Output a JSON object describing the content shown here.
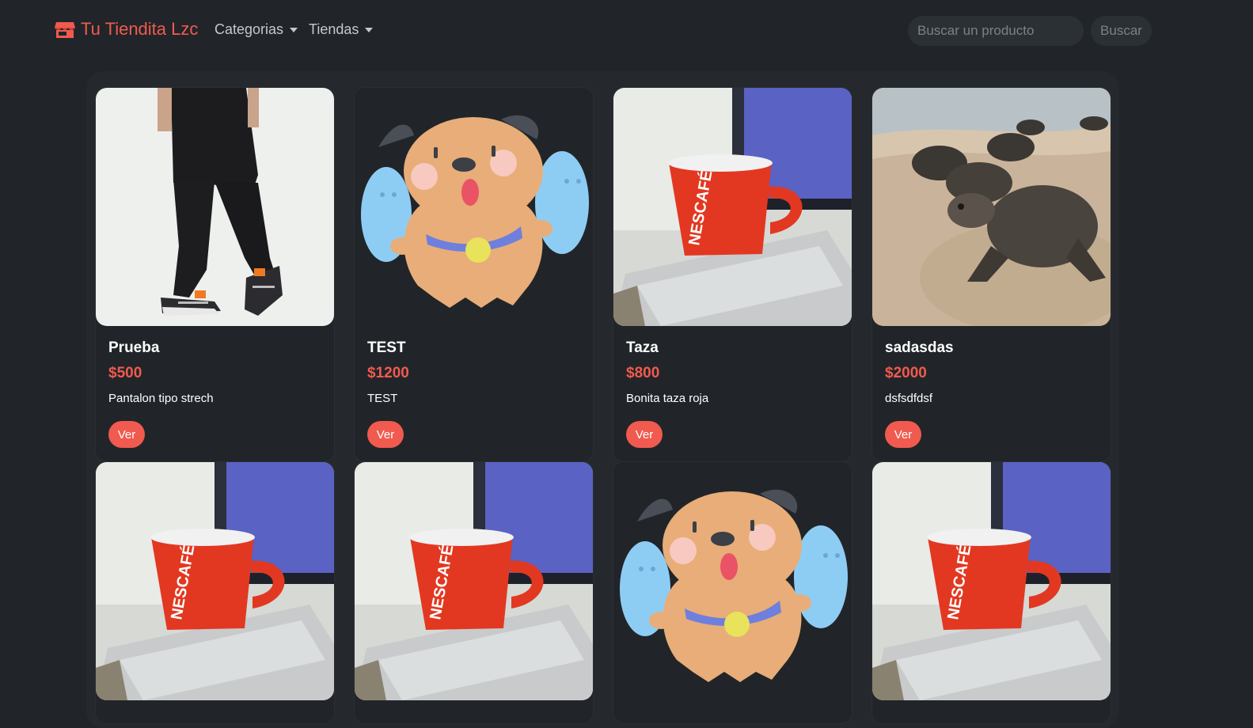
{
  "navbar": {
    "brand": "Tu Tiendita Lzc",
    "brand_icon": "store-icon",
    "menu": [
      {
        "label": "Categorias",
        "icon": "chevron-down-icon"
      },
      {
        "label": "Tiendas",
        "icon": "chevron-down-icon"
      }
    ],
    "search": {
      "value": "",
      "placeholder": "Buscar un producto",
      "button": "Buscar"
    }
  },
  "colors": {
    "background": "#212529",
    "accent": "#f15a4f",
    "card_bg": "#212529",
    "panel_bg": "#25292d"
  },
  "products": [
    {
      "name": "Prueba",
      "price": "$500",
      "description": "Pantalon tipo strech",
      "button": "Ver",
      "image": "pants-photo"
    },
    {
      "name": "TEST",
      "price": "$1200",
      "description": "TEST",
      "button": "Ver",
      "image": "puppy-ghost-illustration"
    },
    {
      "name": "Taza",
      "price": "$800",
      "description": "Bonita taza roja",
      "button": "Ver",
      "image": "red-mug-photo"
    },
    {
      "name": "sadasdas",
      "price": "$2000",
      "description": "dsfsdfdsf",
      "button": "Ver",
      "image": "sea-turtles-photo"
    },
    {
      "name": "",
      "price": "",
      "description": "",
      "button": "",
      "image": "red-mug-photo"
    },
    {
      "name": "",
      "price": "",
      "description": "",
      "button": "",
      "image": "red-mug-photo"
    },
    {
      "name": "",
      "price": "",
      "description": "",
      "button": "",
      "image": "puppy-ghost-illustration"
    },
    {
      "name": "",
      "price": "",
      "description": "",
      "button": "",
      "image": "red-mug-photo"
    }
  ]
}
